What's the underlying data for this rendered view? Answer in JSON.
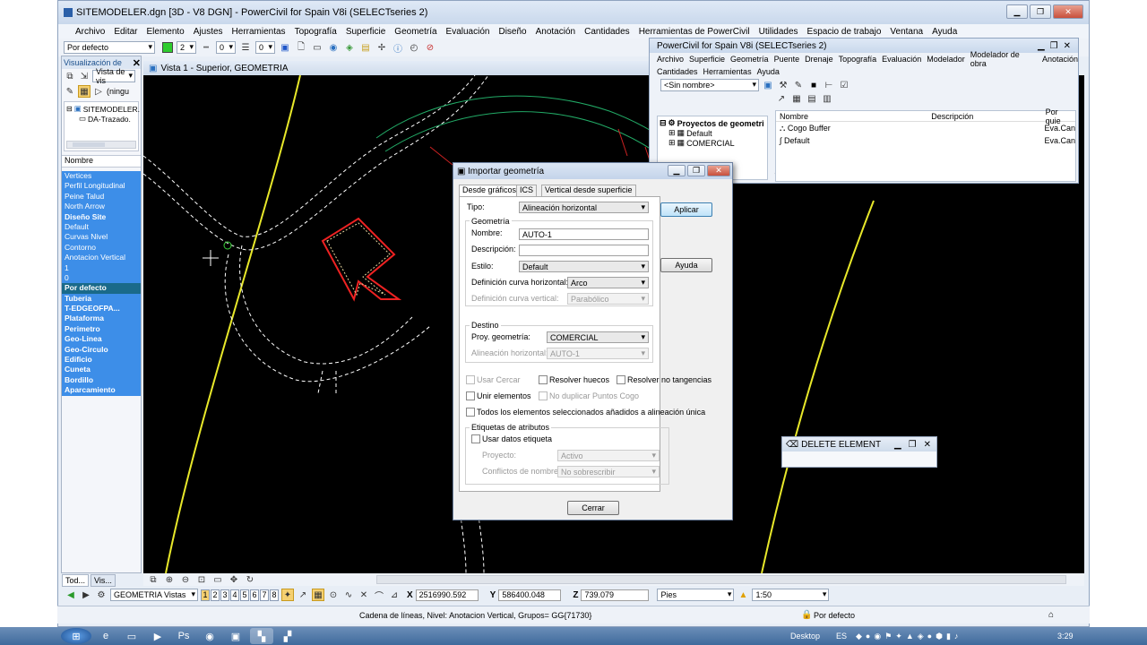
{
  "window": {
    "title": "SITEMODELER.dgn [3D - V8 DGN] - PowerCivil for Spain V8i (SELECTseries 2)"
  },
  "menu": [
    "Archivo",
    "Editar",
    "Elemento",
    "Ajustes",
    "Herramientas",
    "Topografía",
    "Superficie",
    "Geometría",
    "Evaluación",
    "Diseño",
    "Anotación",
    "Cantidades",
    "Herramientas de PowerCivil",
    "Utilidades",
    "Espacio de trabajo",
    "Ventana",
    "Ayuda"
  ],
  "toolbar": {
    "style": "Por defecto",
    "color": "2",
    "weight": "0",
    "linestyle": "0"
  },
  "levels": {
    "title": "Visualización de",
    "view_combo": "Vista de vis",
    "none_combo": "(ningu",
    "tree": [
      "SITEMODELER.",
      "DA-Trazado."
    ],
    "col": "Nombre",
    "items": [
      {
        "n": "Vertices",
        "b": false
      },
      {
        "n": "Perfil Longitudinal",
        "b": false
      },
      {
        "n": "Peine Talud",
        "b": false
      },
      {
        "n": "North Arrow",
        "b": false
      },
      {
        "n": "Diseño Site",
        "b": true
      },
      {
        "n": "Default",
        "b": false
      },
      {
        "n": "Curvas Nivel",
        "b": false
      },
      {
        "n": "Contorno",
        "b": false
      },
      {
        "n": "Anotacion Vertical",
        "b": false
      },
      {
        "n": "1",
        "b": false
      },
      {
        "n": "0",
        "b": false
      },
      {
        "n": "Por defecto",
        "b": true,
        "sel": true
      },
      {
        "n": "Tuberia",
        "b": true
      },
      {
        "n": "T-EDGEOFPA...",
        "b": true
      },
      {
        "n": "Plataforma",
        "b": true
      },
      {
        "n": "Perimetro",
        "b": true
      },
      {
        "n": "Geo-Linea",
        "b": true
      },
      {
        "n": "Geo-Circulo",
        "b": true
      },
      {
        "n": "Edificio",
        "b": true
      },
      {
        "n": "Cuneta",
        "b": true
      },
      {
        "n": "Bordillo",
        "b": true
      },
      {
        "n": "Aparcamiento",
        "b": true
      }
    ],
    "tabs": [
      "Tod...",
      "Vis..."
    ]
  },
  "view": {
    "title": "Vista 1 - Superior, GEOMETRIA"
  },
  "pc": {
    "title": "PowerCivil for Spain V8i (SELECTseries 2)",
    "menu1": [
      "Archivo",
      "Superficie",
      "Geometría",
      "Puente",
      "Drenaje",
      "Topografía",
      "Evaluación",
      "Modelador",
      "Modelador de obra",
      "Anotación"
    ],
    "menu2": [
      "Cantidades",
      "Herramientas",
      "Ayuda"
    ],
    "combo": "<Sin nombre>",
    "tree_root": "Proyectos de geometri",
    "tree_items": [
      "Default",
      "COMERCIAL"
    ],
    "cols": [
      "Nombre",
      "Descripción",
      "Por quie"
    ],
    "rows": [
      {
        "n": "Cogo Buffer",
        "u": "Eva.Can"
      },
      {
        "n": "Default",
        "u": "Eva.Can"
      }
    ],
    "partial": "ef"
  },
  "dialog": {
    "title": "Importar geometría",
    "tabs": [
      "Desde gráficos",
      "ICS",
      "Vertical desde superficie"
    ],
    "tipo_label": "Tipo:",
    "tipo": "Alineación horizontal",
    "geom_group": "Geometría",
    "nombre_label": "Nombre:",
    "nombre": "AUTO-1",
    "desc_label": "Descripción:",
    "estilo_label": "Estilo:",
    "estilo": "Default",
    "dch_label": "Definición curva horizontal:",
    "dch": "Arco",
    "dcv_label": "Definición curva vertical:",
    "dcv": "Parabólico",
    "destino_group": "Destino",
    "proy_label": "Proy. geometría:",
    "proy": "COMERCIAL",
    "alin_label": "Alineación horizontal:",
    "alin": "AUTO-1",
    "cb_usar_cercano": "Usar Cercar",
    "cb_resolver_huecos": "Resolver huecos",
    "cb_resolver_tangencias": "Resolver no tangencias",
    "cb_unir": "Unir elementos",
    "cb_no_duplicar": "No duplicar Puntos Cogo",
    "cb_todos": "Todos los elementos seleccionados añadidos a alineación única",
    "etiq_group": "Etiquetas de atributos",
    "cb_usar_datos": "Usar datos etiqueta",
    "proyecto_label": "Proyecto:",
    "proyecto": "Activo",
    "conflictos_label": "Conflictos de nombre:",
    "conflictos": "No sobrescribir",
    "aplicar": "Aplicar",
    "ayuda": "Ayuda",
    "cerrar": "Cerrar"
  },
  "delete": {
    "title": "DELETE ELEMENT"
  },
  "viewbar": {
    "views": [
      "1",
      "2",
      "3",
      "4",
      "5",
      "6",
      "7",
      "8"
    ],
    "combo": "GEOMETRIA Vistas"
  },
  "coords": {
    "x_label": "X",
    "x": "2516990.592",
    "y_label": "Y",
    "y": "586400.048",
    "z_label": "Z",
    "z": "739.079",
    "units": "Pies",
    "scale": "1:50"
  },
  "status": {
    "msg": "Cadena de líneas, Nivel: Anotacion Vertical, Grupos= GG{71730}",
    "level": "Por defecto"
  },
  "taskbar": {
    "desktop": "Desktop",
    "lang": "ES",
    "time": "3:29"
  }
}
